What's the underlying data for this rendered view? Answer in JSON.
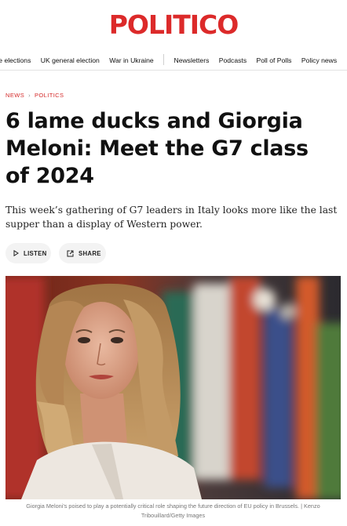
{
  "brand": {
    "logo_text": "POLITICO",
    "accent_color": "#dc2a2a"
  },
  "nav": {
    "items": [
      {
        "label": "ce elections"
      },
      {
        "label": "UK general election"
      },
      {
        "label": "War in Ukraine"
      },
      {
        "label": "Newsletters"
      },
      {
        "label": "Podcasts"
      },
      {
        "label": "Poll of Polls"
      },
      {
        "label": "Policy news"
      }
    ]
  },
  "breadcrumb": {
    "section": "NEWS",
    "subsection": "POLITICS"
  },
  "article": {
    "headline": "6 lame ducks and Giorgia Meloni: Meet the G7 class of 2024",
    "dek": "This week’s gathering of G7 leaders in Italy looks more like the last supper than a display of Western power.",
    "actions": {
      "listen_label": "LISTEN",
      "share_label": "SHARE"
    },
    "image_caption": "Giorgia Meloni's poised to play a potentially critical role shaping the future direction of EU policy in Brussels. | Kenzo Tribouillard/Getty Images"
  }
}
